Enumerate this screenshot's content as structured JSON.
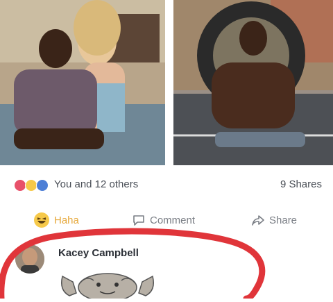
{
  "post": {
    "reactions": {
      "icons": [
        "love-icon",
        "haha-icon",
        "like-icon"
      ],
      "summary": "You and 12 others"
    },
    "shares": "9 Shares"
  },
  "actions": {
    "haha_label": "Haha",
    "comment_label": "Comment",
    "share_label": "Share"
  },
  "comment": {
    "author": "Kacey Campbell",
    "sticker": "rock-monster-sticker"
  },
  "colors": {
    "haha_accent": "#e6a83a",
    "highlight_red": "#e0353a"
  }
}
